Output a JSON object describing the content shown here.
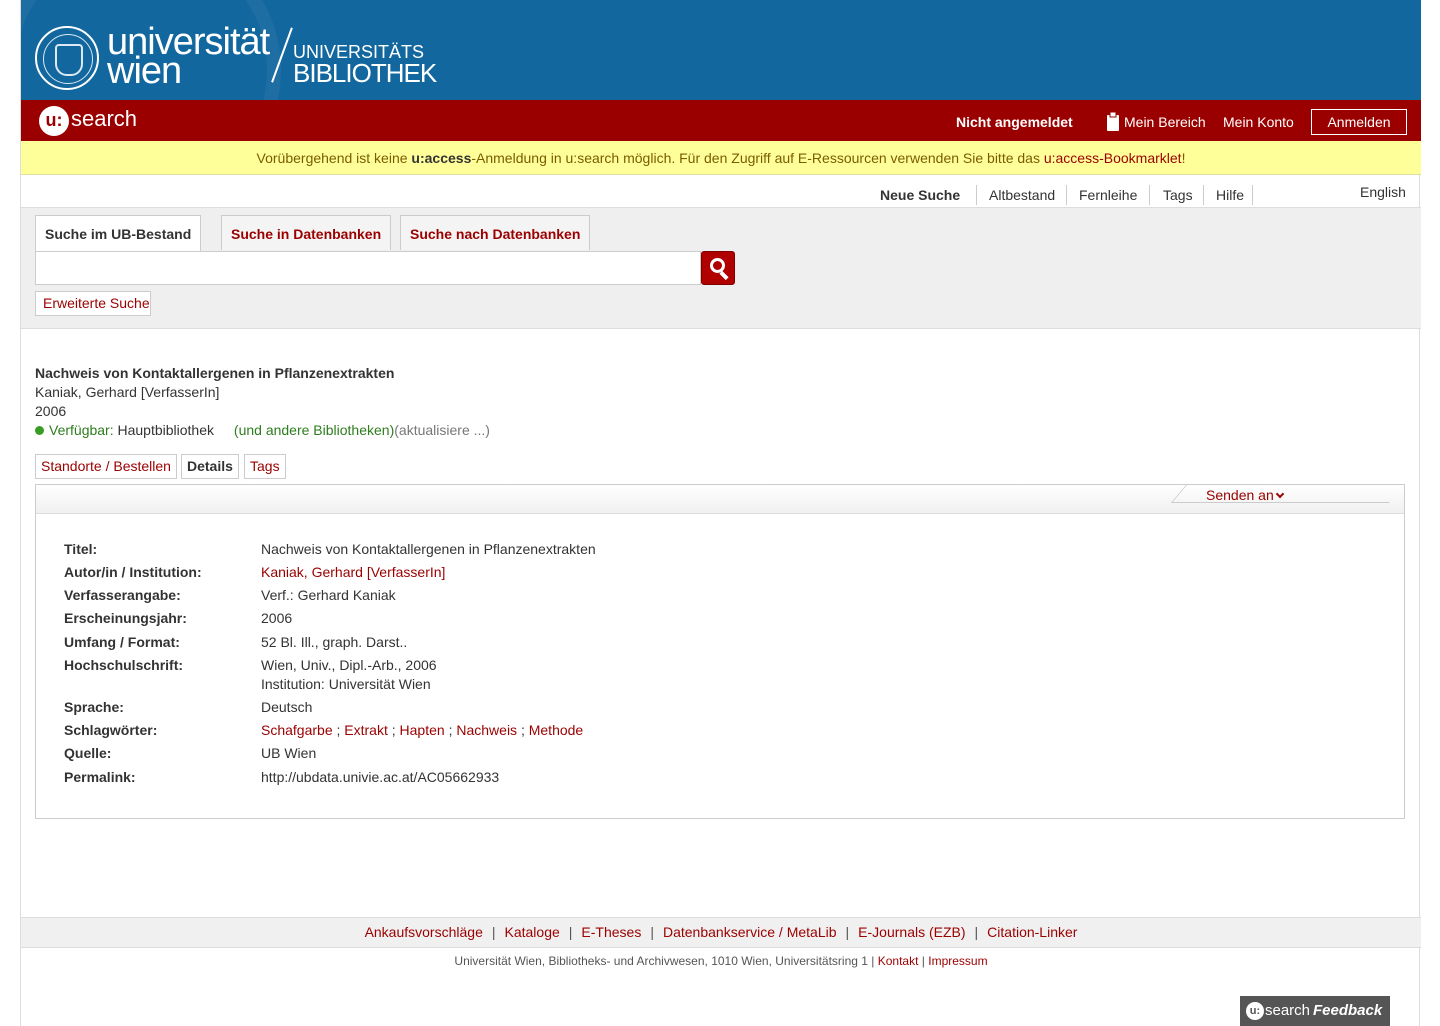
{
  "header": {
    "logo_line1": "universität",
    "logo_line2": "wien",
    "ub_line1": "UNIVERSITÄTS",
    "ub_line2": "BIBLIOTHEK"
  },
  "topbar": {
    "u_glyph": "u:",
    "app_name": "search",
    "login_status": "Nicht angemeldet",
    "mein_bereich": "Mein Bereich",
    "mein_konto": "Mein Konto",
    "login_button": "Anmelden",
    "background_color": "#9b0000"
  },
  "notice": {
    "pre": "Vorübergehend ist keine ",
    "bold": "u:access",
    "mid": "-Anmeldung in u:search möglich. Für den Zugriff auf E-Ressourcen verwenden Sie bitte das ",
    "link": "u:access-Bookmarklet",
    "post": "!"
  },
  "nav": {
    "items": [
      "Neue Suche",
      "Altbestand",
      "Fernleihe",
      "Tags",
      "Hilfe"
    ],
    "language": "English"
  },
  "search": {
    "tabs": [
      "Suche im UB-Bestand",
      "Suche in Datenbanken",
      "Suche nach Datenbanken"
    ],
    "query": "",
    "advanced": "Erweiterte Suche"
  },
  "record": {
    "title": "Nachweis von Kontaktallergenen in Pflanzenextrakten",
    "author": "Kaniak, Gerhard [VerfasserIn]",
    "year": "2006",
    "availability_label": "Verfügbar:",
    "availability_location": " Hauptbibliothek",
    "other_libraries": "(und andere Bibliotheken)",
    "refresh": "(aktualisiere ...)",
    "tabs": [
      "Standorte / Bestellen",
      "Details",
      "Tags"
    ],
    "send_to": "Senden an"
  },
  "details": [
    {
      "label": "Titel:",
      "value": "Nachweis von Kontaktallergenen in Pflanzenextrakten"
    },
    {
      "label": "Autor/in / Institution:",
      "value": "Kaniak, Gerhard [VerfasserIn]"
    },
    {
      "label": "Verfasserangabe:",
      "value": "Verf.: Gerhard Kaniak"
    },
    {
      "label": "Erscheinungsjahr:",
      "value": "2006"
    },
    {
      "label": "Umfang / Format:",
      "value": "52 Bl. Ill., graph. Darst.."
    },
    {
      "label": "Hochschulschrift:",
      "value": "Wien, Univ., Dipl.-Arb., 2006",
      "value2": "Institution: Universität Wien"
    },
    {
      "label": "Sprache:",
      "value": "Deutsch"
    },
    {
      "label": "Schlagwörter:",
      "keywords": [
        "Schafgarbe",
        "Extrakt",
        "Hapten",
        "Nachweis",
        "Methode"
      ]
    },
    {
      "label": "Quelle:",
      "value": "UB Wien"
    },
    {
      "label": "Permalink:",
      "value": "http://ubdata.univie.ac.at/AC05662933"
    }
  ],
  "footer": {
    "links": [
      "Ankaufsvorschläge",
      "Kataloge",
      "E-Theses",
      "Datenbankservice / MetaLib",
      "E-Journals (EZB)",
      "Citation-Linker"
    ],
    "address": "Universität Wien, Bibliotheks- und Archivwesen, 1010 Wien, Universitätsring 1 | ",
    "kontakt": "Kontakt",
    "impressum": "Impressum"
  },
  "feedback": {
    "u": "u:",
    "search": "search",
    "label": "Feedback"
  },
  "colors": {
    "brand_blue": "#12679f",
    "brand_red": "#9b0000",
    "notice_yellow": "#ffff99"
  }
}
